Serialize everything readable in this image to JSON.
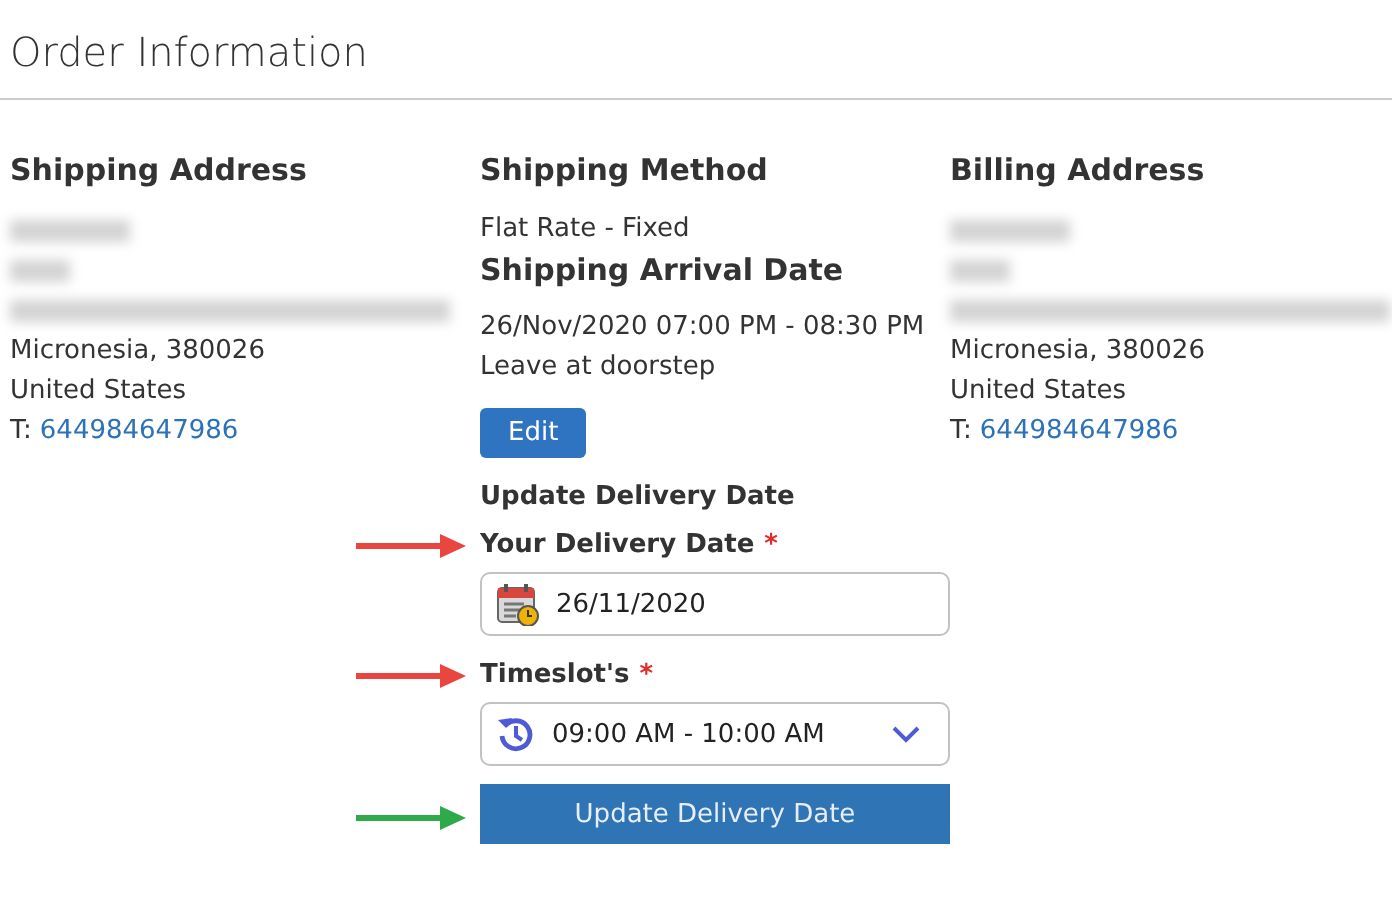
{
  "title": "Order Information",
  "columns": [
    {
      "heading": "Shipping Address",
      "kind": "address",
      "lines": [
        "Micronesia, 380026",
        "United States"
      ],
      "phone_prefix": "T:",
      "phone": "644984647986"
    },
    {
      "heading": "Shipping Method",
      "kind": "shipping",
      "method": "Flat Rate - Fixed",
      "arrival_heading": "Shipping Arrival Date",
      "arrival": "26/Nov/2020 07:00 PM - 08:30 PM",
      "note": "Leave at doorstep",
      "edit_button": "Edit",
      "update_heading": "Update Delivery Date",
      "fields": [
        {
          "kind": "date",
          "label": "Your Delivery Date",
          "required": "*",
          "value": "26/11/2020",
          "color": "#e8463f"
        },
        {
          "kind": "select",
          "label": "Timeslot's",
          "required": "*",
          "value": "09:00 AM - 10:00 AM",
          "color": "#e8463f"
        }
      ],
      "submit": {
        "label": "Update Delivery Date",
        "color": "#2eaa4a"
      }
    },
    {
      "heading": "Billing Address",
      "kind": "address",
      "lines": [
        "Micronesia, 380026",
        "United States"
      ],
      "phone_prefix": "T:",
      "phone": "644984647986"
    }
  ]
}
